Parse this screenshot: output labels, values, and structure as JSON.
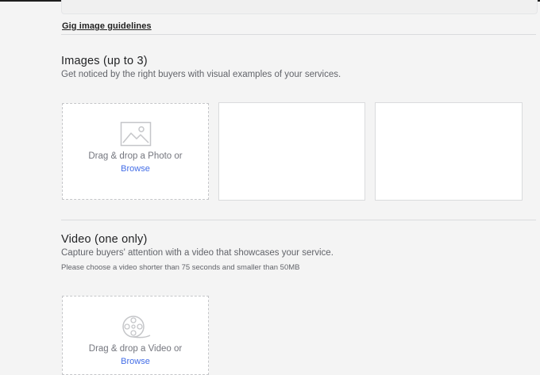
{
  "guidelines_link": "Gig image guidelines",
  "images": {
    "title": "Images (up to 3)",
    "description": "Get noticed by the right buyers with visual examples of your services.",
    "drop_text": "Drag & drop a Photo or",
    "browse": "Browse",
    "icon": "image-icon"
  },
  "video": {
    "title": "Video (one only)",
    "description": "Capture buyers' attention with a video that showcases your service.",
    "note": "Please choose a video shorter than 75 seconds and smaller than 50MB",
    "drop_text": "Drag & drop a Video or",
    "browse": "Browse",
    "icon": "film-reel-icon"
  },
  "colors": {
    "background": "#f4f4f4",
    "link": "#446ee7",
    "border": "#dadbdd"
  }
}
